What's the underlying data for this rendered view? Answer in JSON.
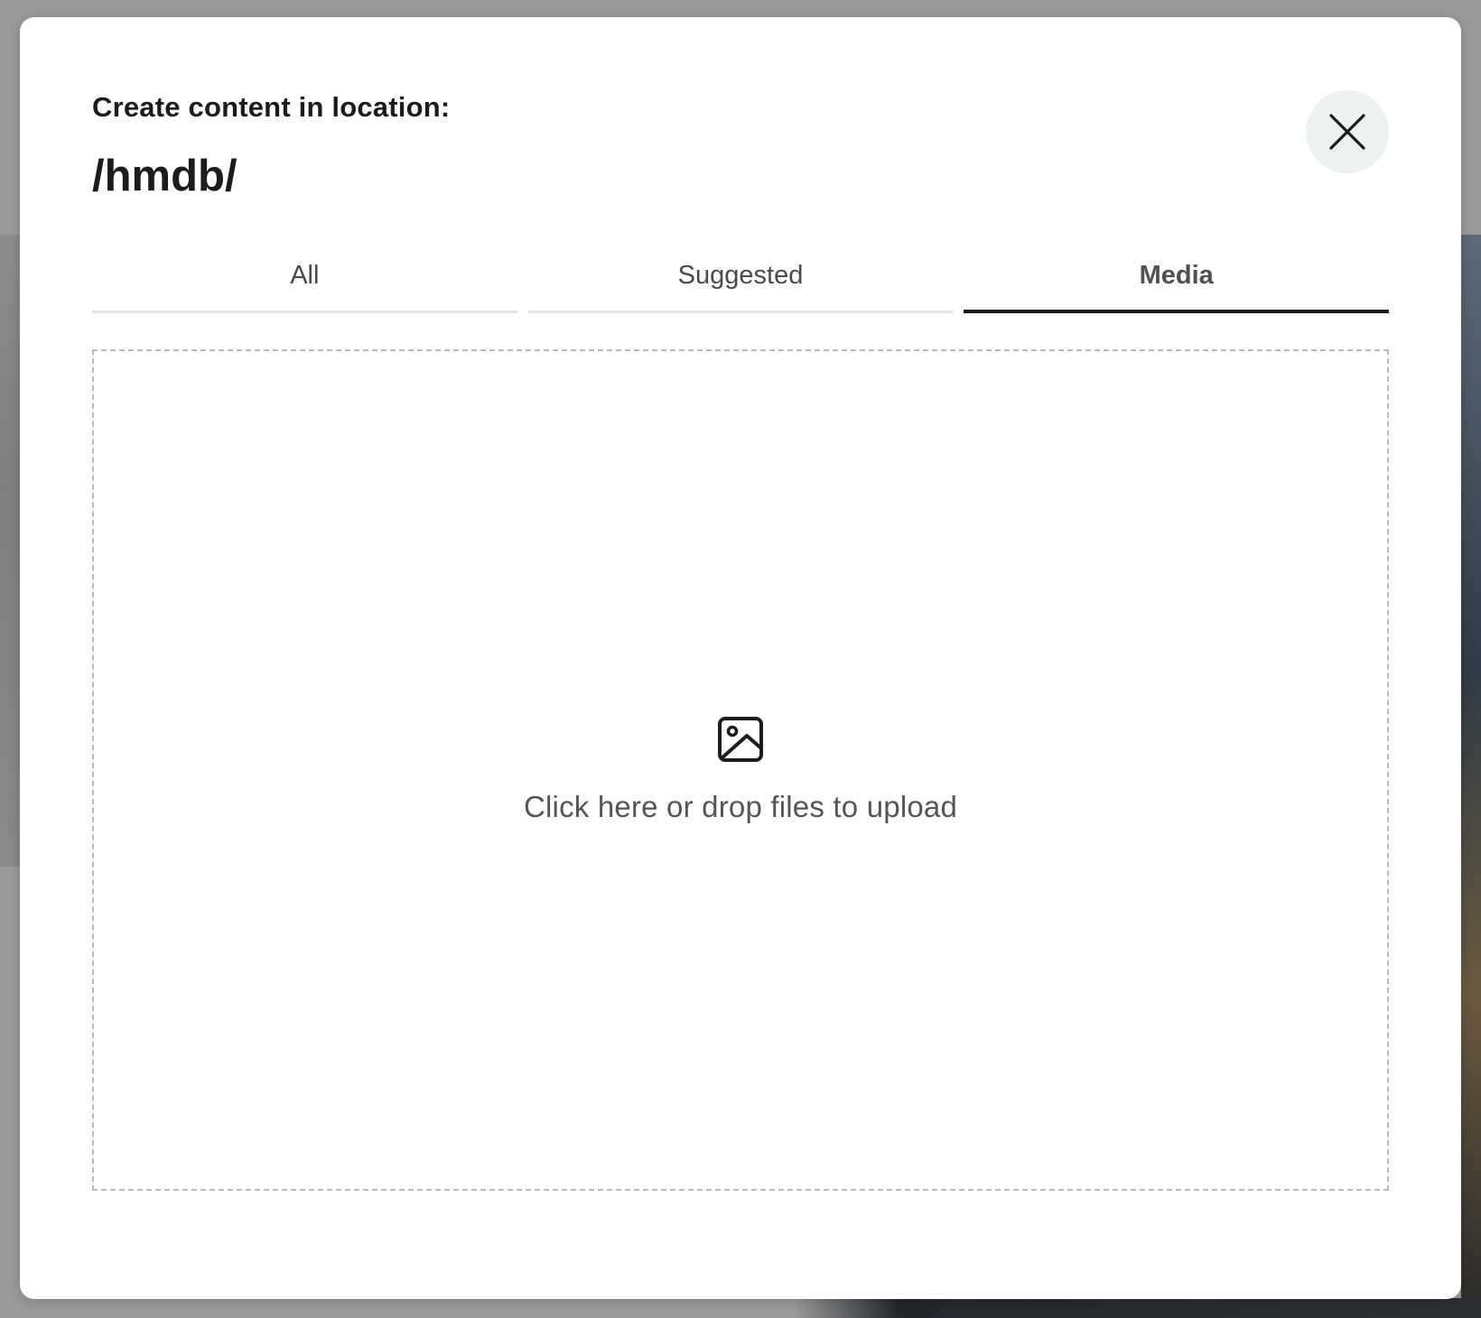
{
  "dialog": {
    "heading": "Create content in location:",
    "location_path": "/hmdb/",
    "close_icon": "close-icon"
  },
  "tabs": [
    {
      "label": "All",
      "active": false
    },
    {
      "label": "Suggested",
      "active": false
    },
    {
      "label": "Media",
      "active": true
    }
  ],
  "dropzone": {
    "icon": "image-icon",
    "text": "Click here or drop files to upload"
  },
  "colors": {
    "overlay": "#9a9a9a",
    "modal_bg": "#ffffff",
    "active_tab_underline": "#1a1a1a",
    "inactive_tab_underline": "#e2e2e2",
    "close_button_bg": "#eef1f2",
    "dropzone_border": "#b9b9b9"
  }
}
